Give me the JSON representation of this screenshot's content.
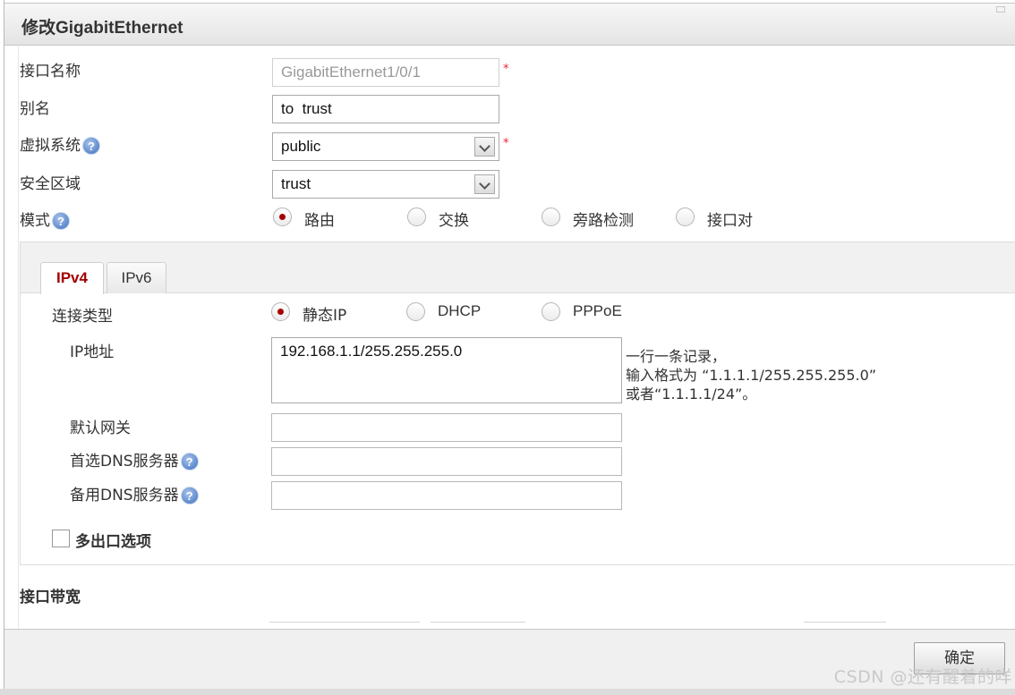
{
  "dialog": {
    "title": "修改GigabitEthernet",
    "ok_label": "确定"
  },
  "form": {
    "interface_name_label": "接口名称",
    "interface_name_value": "GigabitEthernet1/0/1",
    "alias_label": "别名",
    "alias_value": "to  trust",
    "vsys_label": "虚拟系统",
    "vsys_value": "public",
    "zone_label": "安全区域",
    "zone_value": "trust",
    "mode_label": "模式",
    "mode_options": [
      "路由",
      "交换",
      "旁路检测",
      "接口对"
    ],
    "mode_selected": "路由",
    "required_mark": "*",
    "help_glyph": "?"
  },
  "tabs": [
    "IPv4",
    "IPv6"
  ],
  "ipv4": {
    "conn_type_label": "连接类型",
    "conn_options": [
      "静态IP",
      "DHCP",
      "PPPoE"
    ],
    "conn_selected": "静态IP",
    "ip_label": "IP地址",
    "ip_value": "192.168.1.1/255.255.255.0",
    "ip_hint_1": "一行一条记录，",
    "ip_hint_2": "输入格式为 “1.1.1.1/255.255.255.0”",
    "ip_hint_3": "或者“1.1.1.1/24”。",
    "gateway_label": "默认网关",
    "dns1_label": "首选DNS服务器",
    "dns2_label": "备用DNS服务器",
    "multi_exit_label": "多出口选项"
  },
  "bandwidth": {
    "section_label": "接口带宽"
  },
  "watermark": "CSDN @还有醒着的咩"
}
